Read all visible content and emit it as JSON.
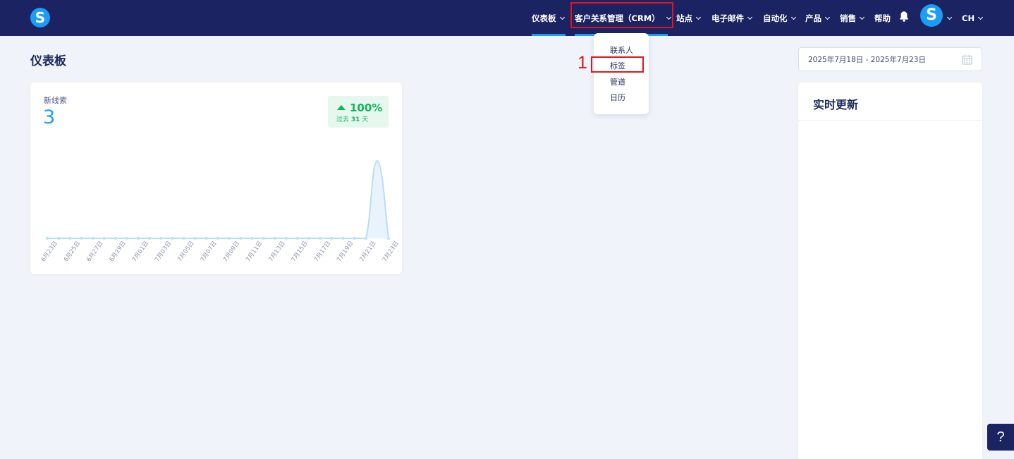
{
  "nav": {
    "logo": "S",
    "items": [
      {
        "label": "仪表板"
      },
      {
        "label": "客户关系管理（CRM）"
      },
      {
        "label": "站点"
      },
      {
        "label": "电子邮件"
      },
      {
        "label": "自动化"
      },
      {
        "label": "产品"
      },
      {
        "label": "销售"
      },
      {
        "label": "帮助"
      }
    ],
    "avatar": "S",
    "lang": "CH"
  },
  "dropdown": {
    "items": [
      {
        "label": "联系人"
      },
      {
        "label": "标签"
      },
      {
        "label": "管道"
      },
      {
        "label": "日历"
      }
    ],
    "highlighted": "标签"
  },
  "annotation": {
    "marker": "1"
  },
  "page": {
    "title": "仪表板",
    "date_range": "2025年7月18日 - 2025年7月23日"
  },
  "card": {
    "label": "新线索",
    "value": "3",
    "badge_pct": "100%",
    "badge_prefix": "过去",
    "badge_days": "31",
    "badge_suffix": "天"
  },
  "live": {
    "title": "实时更新"
  },
  "help": {
    "label": "?"
  },
  "colors": {
    "nav_bg": "#1b2362",
    "accent": "#1a9df5",
    "positive": "#12b55c",
    "annotation": "#e3141b"
  },
  "chart_data": {
    "type": "line",
    "x": [
      "6月23日",
      "6月24日",
      "6月25日",
      "6月26日",
      "6月27日",
      "6月28日",
      "6月29日",
      "6月30日",
      "7月01日",
      "7月02日",
      "7月03日",
      "7月04日",
      "7月05日",
      "7月06日",
      "7月07日",
      "7月08日",
      "7月09日",
      "7月10日",
      "7月11日",
      "7月12日",
      "7月13日",
      "7月14日",
      "7月15日",
      "7月16日",
      "7月17日",
      "7月18日",
      "7月19日",
      "7月20日",
      "7月21日",
      "7月22日",
      "7月23日"
    ],
    "tick_labels": [
      "6月23日",
      "6月25日",
      "6月27日",
      "6月29日",
      "7月01日",
      "7月03日",
      "7月05日",
      "7月07日",
      "7月09日",
      "7月11日",
      "7月13日",
      "7月15日",
      "7月17日",
      "7月19日",
      "7月21日",
      "7月23日"
    ],
    "values": [
      0,
      0,
      0,
      0,
      0,
      0,
      0,
      0,
      0,
      0,
      0,
      0,
      0,
      0,
      0,
      0,
      0,
      0,
      0,
      0,
      0,
      0,
      0,
      0,
      0,
      0,
      0,
      0,
      0,
      3,
      0
    ],
    "ylim": [
      0,
      3
    ],
    "grid": false
  }
}
